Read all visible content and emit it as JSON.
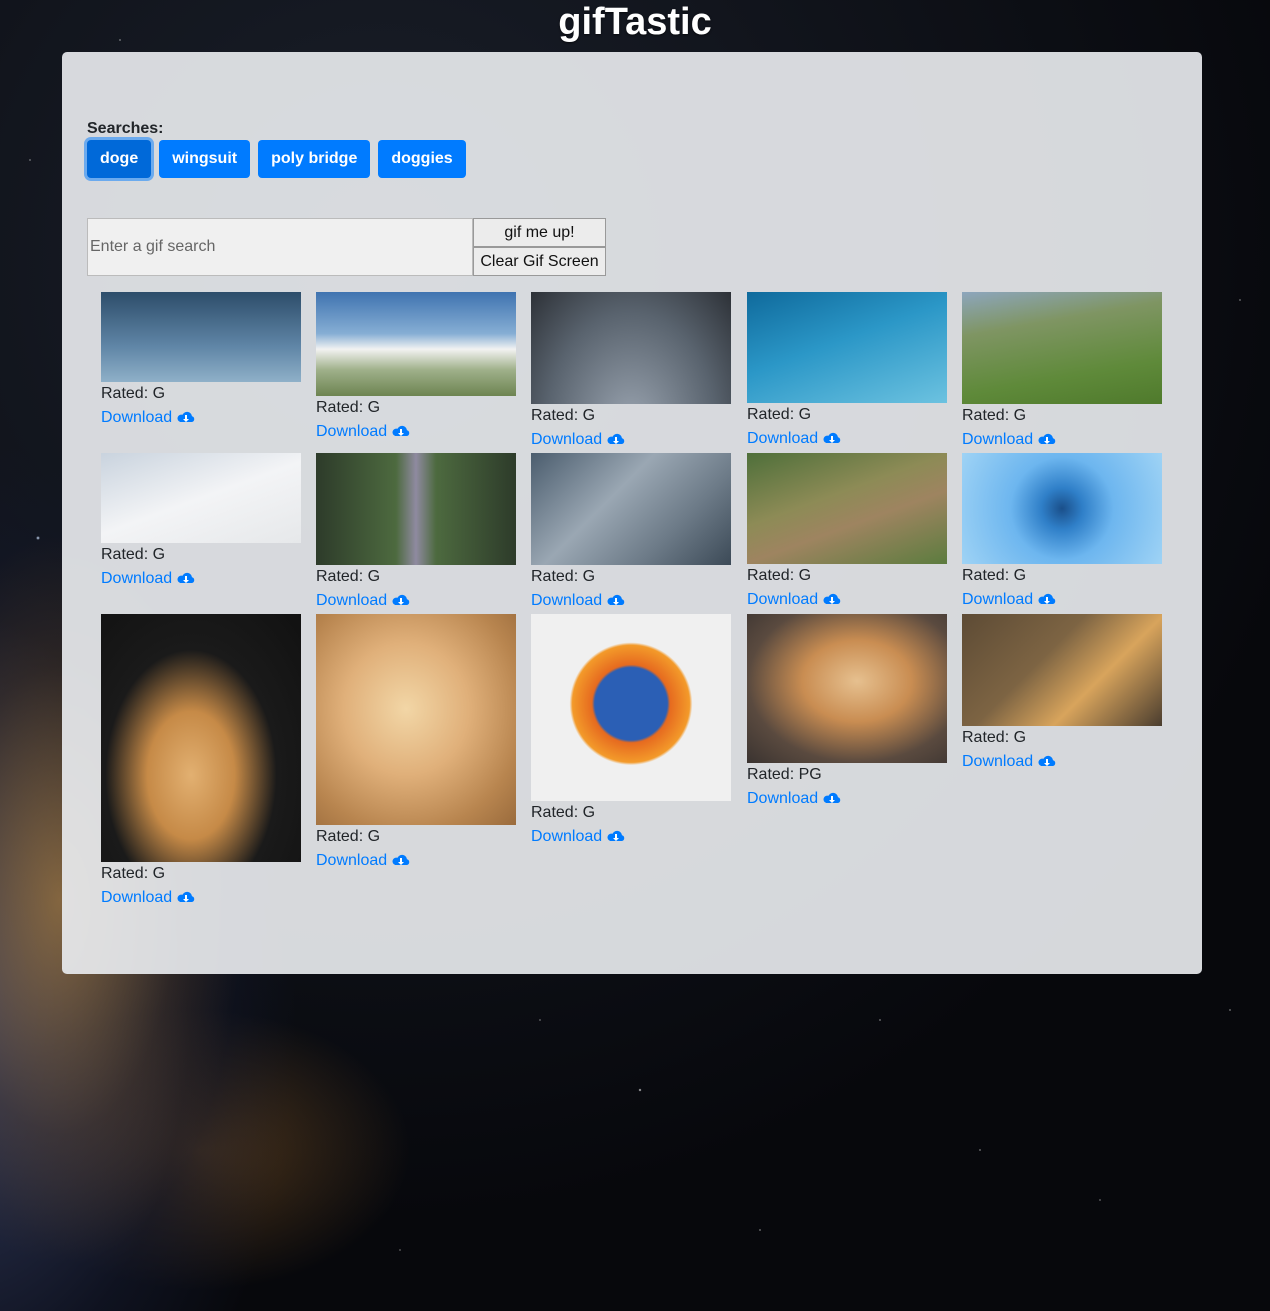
{
  "app": {
    "title": "gifTastic"
  },
  "searches": {
    "label": "Searches:",
    "buttons": [
      "doge",
      "wingsuit",
      "poly bridge",
      "doggies"
    ],
    "active_index": 0
  },
  "form": {
    "placeholder": "Enter a gif search",
    "submit_label": "gif me up!",
    "clear_label": "Clear Gif Screen"
  },
  "colors": {
    "accent": "#007bff",
    "link": "#007bff"
  },
  "gifs": [
    {
      "rating": "Rated: G",
      "download": "Download",
      "scene": "wingsuit-sky"
    },
    {
      "rating": "Rated: G",
      "download": "Download",
      "scene": "clouds-hill"
    },
    {
      "rating": "Rated: G",
      "download": "Download",
      "scene": "parachute"
    },
    {
      "rating": "Rated: G",
      "download": "Download",
      "scene": "ocean-skydive"
    },
    {
      "rating": "Rated: G",
      "download": "Download",
      "scene": "green-slope"
    },
    {
      "rating": "Rated: G",
      "download": "Download",
      "scene": "snow-wingsuit"
    },
    {
      "rating": "Rated: G",
      "download": "Download",
      "scene": "forest-flyby"
    },
    {
      "rating": "Rated: G",
      "download": "Download",
      "scene": "skyscrapers"
    },
    {
      "rating": "Rated: G",
      "download": "Download",
      "scene": "terraced-hills"
    },
    {
      "rating": "Rated: G",
      "download": "Download",
      "scene": "tiny-planet"
    },
    {
      "rating": "Rated: G",
      "download": "Download",
      "scene": "doge-space"
    },
    {
      "rating": "Rated: G",
      "download": "Download",
      "scene": "doge-bark"
    },
    {
      "rating": "Rated: G",
      "download": "Download",
      "scene": "firefox-logo"
    },
    {
      "rating": "Rated: PG",
      "download": "Download",
      "scene": "shiba-side"
    },
    {
      "rating": "Rated: G",
      "download": "Download",
      "scene": "doge-hardhat"
    }
  ]
}
